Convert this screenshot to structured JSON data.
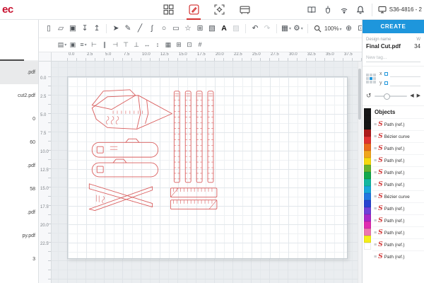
{
  "header": {
    "logo_text": "ec",
    "device_label": "S36-4816 - 2",
    "nav_items": [
      "dashboard-icon",
      "design-icon",
      "positioning-icon",
      "production-icon"
    ],
    "status_icons": [
      "manual-icon",
      "connector-icon",
      "network-icon",
      "bell-icon",
      "monitor-icon"
    ]
  },
  "toolbar1": {
    "file_icons": [
      {
        "name": "new-document-icon",
        "glyph": "▯"
      },
      {
        "name": "open-document-icon",
        "glyph": "▱"
      },
      {
        "name": "save-icon",
        "glyph": "▣"
      },
      {
        "name": "import-icon",
        "glyph": "↧"
      },
      {
        "name": "export-icon",
        "glyph": "↥"
      }
    ],
    "tool_icons": [
      {
        "name": "select-tool-icon",
        "glyph": "➤"
      },
      {
        "name": "node-edit-tool-icon",
        "glyph": "✎"
      },
      {
        "name": "line-tool-icon",
        "glyph": "╱"
      },
      {
        "name": "curve-tool-icon",
        "glyph": "ʃ"
      },
      {
        "name": "ellipse-tool-icon",
        "glyph": "○"
      },
      {
        "name": "rectangle-tool-icon",
        "glyph": "▭"
      },
      {
        "name": "polygon-tool-icon",
        "glyph": "☆"
      },
      {
        "name": "array-tool-icon",
        "glyph": "⊞"
      },
      {
        "name": "image-tool-icon",
        "glyph": "▧"
      },
      {
        "name": "text-tool-icon",
        "glyph": "A",
        "active": true
      },
      {
        "name": "bitmap-trace-icon",
        "glyph": "▨",
        "disabled": true
      }
    ],
    "history_icons": [
      {
        "name": "undo-icon",
        "glyph": "↶"
      },
      {
        "name": "redo-icon",
        "glyph": "↷",
        "disabled": true
      }
    ],
    "option_icons": [
      {
        "name": "snap-options-icon",
        "glyph": "▦",
        "caret": true
      },
      {
        "name": "settings-icon",
        "glyph": "⚙",
        "caret": true
      }
    ],
    "zoom_value": "100%"
  },
  "toolbar2": {
    "icons": [
      {
        "name": "artboard-settings-icon",
        "glyph": "▤",
        "caret": true
      },
      {
        "name": "duplicate-icon",
        "glyph": "▣"
      },
      {
        "name": "order-icon",
        "glyph": "≡",
        "caret": true
      },
      {
        "name": "align-left-icon",
        "glyph": "⊢"
      },
      {
        "name": "align-center-icon",
        "glyph": "∥"
      },
      {
        "name": "align-right-icon",
        "glyph": "⊣"
      },
      {
        "name": "align-top-icon",
        "glyph": "⊤"
      },
      {
        "name": "align-bottom-icon",
        "glyph": "⊥"
      },
      {
        "name": "distribute-horizontal-icon",
        "glyph": "↔"
      },
      {
        "name": "distribute-vertical-icon",
        "glyph": "↕"
      },
      {
        "name": "grid-toggle-icon",
        "glyph": "▦"
      },
      {
        "name": "snap-grid-icon",
        "glyph": "⊞"
      },
      {
        "name": "snap-objects-icon",
        "glyph": "⊡"
      },
      {
        "name": "guides-toggle-icon",
        "glyph": "#"
      }
    ]
  },
  "file_panel": {
    "items": [
      {
        "label": ".pdf",
        "selected": true
      },
      {
        "label": "cut2.pdf"
      },
      {
        "label": "0"
      },
      {
        "label": "60"
      },
      {
        "label": ".pdf"
      },
      {
        "label": "58"
      },
      {
        "label": ".pdf"
      },
      {
        "label": "py.pdf"
      },
      {
        "label": "3"
      }
    ]
  },
  "rulers": {
    "top": [
      "0.0",
      "2.5",
      "5.0",
      "7.5",
      "10.0",
      "12.5",
      "15.0",
      "17.5",
      "20.0",
      "22.5",
      "25.0",
      "27.5",
      "30.0",
      "32.5",
      "35.0",
      "37.5"
    ],
    "left": [
      "0.0",
      "2.5",
      "5.0",
      "7.5",
      "10.0",
      "12.5",
      "15.0",
      "17.5",
      "20.0",
      "22.5"
    ]
  },
  "right_panel": {
    "create_button": "CREATE",
    "design_name_label": "Design name",
    "design_name": "Final Cut.pdf",
    "width_label": "W",
    "width_value": "34",
    "new_tag_placeholder": "New tag...",
    "x_label": "x",
    "y_label": "y",
    "objects_title": "Objects",
    "accent_color": "#1e96dc",
    "path_color": "#d95c5c",
    "palette": [
      "#151515",
      "#151515",
      "#151515",
      "#ad1a1a",
      "#e03131",
      "#ea6a1d",
      "#f0a51d",
      "#f5d90f",
      "#66b32d",
      "#12a84b",
      "#12b8a0",
      "#18a8d8",
      "#2277e0",
      "#2743d0",
      "#7040d8",
      "#aa28c8",
      "#e02bb0",
      "#ee77b0",
      "#f5ef18",
      "#ffffff"
    ],
    "objects": [
      {
        "type": "path",
        "label": "Path (ref.)"
      },
      {
        "type": "bezier",
        "label": "Bézier curve"
      },
      {
        "type": "path",
        "label": "Path (ref.)"
      },
      {
        "type": "path",
        "label": "Path (ref.)"
      },
      {
        "type": "path",
        "label": "Path (ref.)"
      },
      {
        "type": "path",
        "label": "Path (ref.)"
      },
      {
        "type": "bezier",
        "label": "Bézier curve"
      },
      {
        "type": "path",
        "label": "Path (ref.)"
      },
      {
        "type": "path",
        "label": "Path (ref.)"
      },
      {
        "type": "path",
        "label": "Path (ref.)"
      },
      {
        "type": "path",
        "label": "Path (ref.)"
      },
      {
        "type": "path",
        "label": "Path (ref.)"
      }
    ]
  }
}
